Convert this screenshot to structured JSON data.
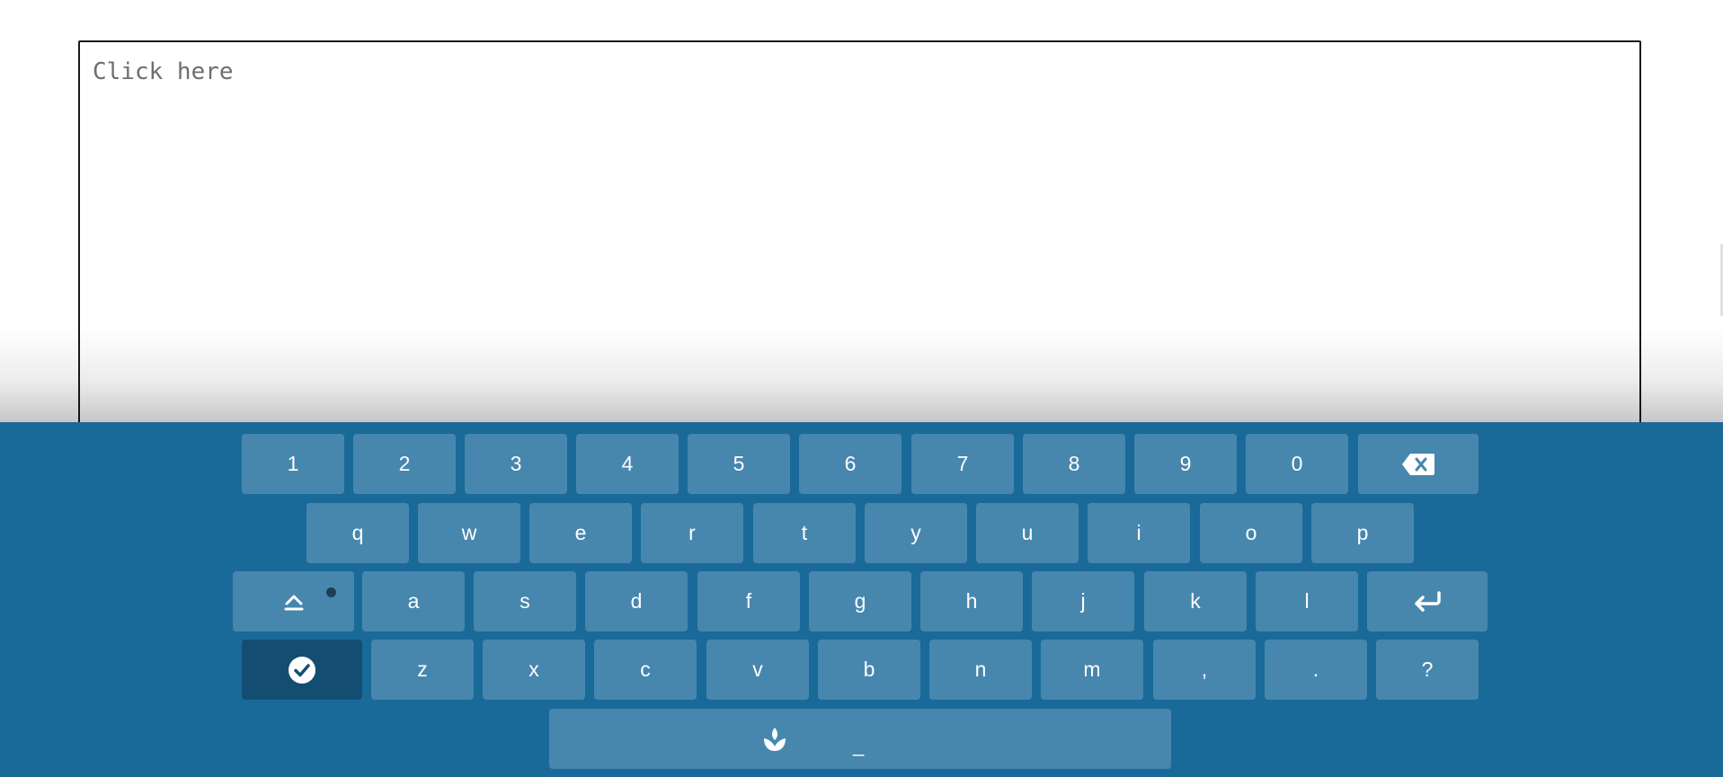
{
  "editor": {
    "placeholder": "Click here",
    "value": ""
  },
  "keyboard": {
    "row1": [
      "1",
      "2",
      "3",
      "4",
      "5",
      "6",
      "7",
      "8",
      "9",
      "0"
    ],
    "row2": [
      "q",
      "w",
      "e",
      "r",
      "t",
      "y",
      "u",
      "i",
      "o",
      "p"
    ],
    "row3": [
      "a",
      "s",
      "d",
      "f",
      "g",
      "h",
      "j",
      "k",
      "l"
    ],
    "row4": [
      "z",
      "x",
      "c",
      "v",
      "b",
      "n",
      "m",
      ",",
      ".",
      "?"
    ],
    "space_label": "_",
    "shift_indicator_on": true,
    "icons": {
      "backspace": "backspace-icon",
      "enter": "enter-icon",
      "shift": "shift-icon",
      "done": "checkmark-icon",
      "space": "lotus-icon"
    },
    "colors": {
      "background": "#1a6a99",
      "key": "#4787ae",
      "key_dark": "#134e72",
      "key_text": "#ffffff"
    }
  }
}
